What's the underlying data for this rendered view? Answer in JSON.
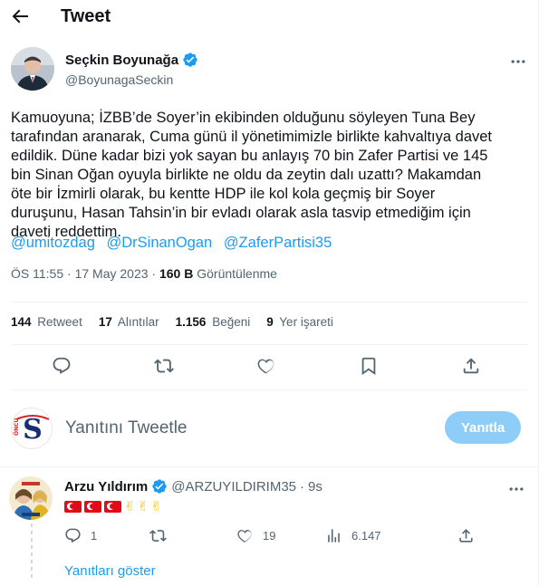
{
  "header": {
    "title": "Tweet"
  },
  "author": {
    "name": "Seçkin Boyunağa",
    "handle": "@BoyunagaSeckin"
  },
  "tweet": {
    "lines": [
      "Kamuoyuna; İZBB’de Soyer’in ekibinden olduğunu söyleyen Tuna Bey",
      "tarafından aranarak, Cuma günü il yönetimimizle birlikte kahvaltıya davet",
      "edildik. Düne kadar bizi yok sayan bu anlayış 70 bin Zafer Partisi ve 145",
      "bin Sinan Oğan oyuyla birlikte ne oldu da zeytin dalı uzattı? Makamdan",
      "öte bir İzmirli olarak, bu kentte HDP ile kol kola geçmiş bir Soyer",
      "duruşunu, Hasan Tahsin’in bir evladı olarak asla tasvip etmediğim için",
      "daveti reddettim."
    ],
    "mentions": [
      "@umitozdag",
      "@DrSinanOgan",
      "@ZaferPartisi35"
    ],
    "time": "ÖS 11:55",
    "date": "17 May 2023",
    "views_count": "160 B",
    "views_label": "Görüntülenme"
  },
  "stats": {
    "retweets": "144",
    "retweets_label": "Retweet",
    "quotes": "17",
    "quotes_label": "Alıntılar",
    "likes": "1.156",
    "likes_label": "Beğeni",
    "bookmarks": "9",
    "bookmarks_label": "Yer işareti"
  },
  "reply_box": {
    "placeholder": "Yanıtını Tweetle",
    "button": "Yanıtla",
    "button_color": "#8ecdf8"
  },
  "reply": {
    "name": "Arzu Yıldırım",
    "handle": "@ARZUYILDIRIM35",
    "separator": "·",
    "time": "9s",
    "reply_count": "1",
    "retweet_count": "",
    "like_count": "19",
    "view_count": "6.147",
    "show_replies": "Yanıtları göster"
  },
  "icons": {
    "back": "arrow-left-icon",
    "verified": "verified-badge-icon",
    "more": "more-icon",
    "reply": "reply-icon",
    "retweet": "retweet-icon",
    "like": "heart-icon",
    "bookmark": "bookmark-icon",
    "share": "share-icon",
    "views": "views-icon"
  },
  "colors": {
    "accent": "#1d9bf0",
    "text": "#0f1419",
    "muted": "#536471",
    "turkey_flag": "#e30a17"
  }
}
